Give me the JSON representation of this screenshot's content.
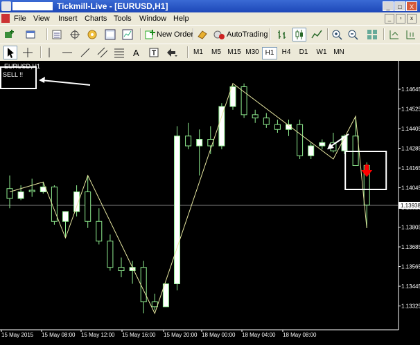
{
  "window": {
    "title": "Tickmill-Live - [EURUSD,H1]",
    "buttons": [
      "_",
      "□",
      "X"
    ]
  },
  "menu": [
    "File",
    "View",
    "Insert",
    "Charts",
    "Tools",
    "Window",
    "Help"
  ],
  "toolbar": {
    "new_order": "New Order",
    "autotrading": "AutoTrading"
  },
  "timeframes": [
    "M1",
    "M5",
    "M15",
    "M30",
    "H1",
    "H4",
    "D1",
    "W1",
    "MN"
  ],
  "active_timeframe": "H1",
  "chart": {
    "symbol_label": "EURUSD,H1",
    "annotation": "SELL !!",
    "current_price": "1.13938",
    "price_ticks": [
      "1.14645",
      "1.14525",
      "1.14405",
      "1.14285",
      "1.14165",
      "1.14045",
      "1.13925",
      "1.13805",
      "1.13685",
      "1.13565",
      "1.13445",
      "1.13325"
    ],
    "time_ticks": [
      "15 May 2015",
      "15 May 08:00",
      "15 May 12:00",
      "15 May 16:00",
      "15 May 20:00",
      "18 May 00:00",
      "18 May 04:00",
      "18 May 08:00"
    ],
    "colors": {
      "background": "#000000",
      "bull_body": "#ffffff",
      "bear_body": "#000000",
      "candle_wick": "#90ee90",
      "zigzag": "#e6e6a0",
      "price_line": "#808080",
      "signal_arrow": "#ff0000",
      "annotation": "#ffffff"
    }
  },
  "chart_data": {
    "type": "candlestick",
    "symbol": "EURUSD",
    "timeframe": "H1",
    "ylim": [
      1.1326,
      1.147
    ],
    "candles": [
      {
        "o": 1.1404,
        "h": 1.1412,
        "l": 1.1392,
        "c": 1.1398
      },
      {
        "o": 1.1398,
        "h": 1.1406,
        "l": 1.1397,
        "c": 1.1402
      },
      {
        "o": 1.1403,
        "h": 1.141,
        "l": 1.1399,
        "c": 1.1402
      },
      {
        "o": 1.1402,
        "h": 1.1408,
        "l": 1.1401,
        "c": 1.1405
      },
      {
        "o": 1.1405,
        "h": 1.1406,
        "l": 1.1382,
        "c": 1.1384
      },
      {
        "o": 1.1384,
        "h": 1.139,
        "l": 1.1374,
        "c": 1.139
      },
      {
        "o": 1.139,
        "h": 1.1406,
        "l": 1.1387,
        "c": 1.1402
      },
      {
        "o": 1.1402,
        "h": 1.1412,
        "l": 1.138,
        "c": 1.1384
      },
      {
        "o": 1.1384,
        "h": 1.1392,
        "l": 1.137,
        "c": 1.1372
      },
      {
        "o": 1.1372,
        "h": 1.1376,
        "l": 1.1354,
        "c": 1.1356
      },
      {
        "o": 1.1356,
        "h": 1.1362,
        "l": 1.135,
        "c": 1.1354
      },
      {
        "o": 1.1354,
        "h": 1.136,
        "l": 1.1346,
        "c": 1.1356
      },
      {
        "o": 1.1356,
        "h": 1.136,
        "l": 1.1328,
        "c": 1.1335
      },
      {
        "o": 1.1335,
        "h": 1.134,
        "l": 1.133,
        "c": 1.1332
      },
      {
        "o": 1.1332,
        "h": 1.1346,
        "l": 1.1332,
        "c": 1.1346
      },
      {
        "o": 1.1346,
        "h": 1.1442,
        "l": 1.1342,
        "c": 1.1436
      },
      {
        "o": 1.1436,
        "h": 1.1444,
        "l": 1.1428,
        "c": 1.143
      },
      {
        "o": 1.143,
        "h": 1.144,
        "l": 1.1412,
        "c": 1.1434
      },
      {
        "o": 1.1434,
        "h": 1.1442,
        "l": 1.1425,
        "c": 1.143
      },
      {
        "o": 1.143,
        "h": 1.1456,
        "l": 1.1428,
        "c": 1.1454
      },
      {
        "o": 1.1454,
        "h": 1.1467,
        "l": 1.1452,
        "c": 1.1466
      },
      {
        "o": 1.1466,
        "h": 1.1468,
        "l": 1.1447,
        "c": 1.1449
      },
      {
        "o": 1.1449,
        "h": 1.1452,
        "l": 1.1444,
        "c": 1.1447
      },
      {
        "o": 1.1447,
        "h": 1.145,
        "l": 1.1441,
        "c": 1.1443
      },
      {
        "o": 1.1443,
        "h": 1.1446,
        "l": 1.1438,
        "c": 1.144
      },
      {
        "o": 1.144,
        "h": 1.1446,
        "l": 1.1436,
        "c": 1.1443
      },
      {
        "o": 1.1443,
        "h": 1.1446,
        "l": 1.1422,
        "c": 1.1424
      },
      {
        "o": 1.1424,
        "h": 1.1432,
        "l": 1.1422,
        "c": 1.143
      },
      {
        "o": 1.143,
        "h": 1.1434,
        "l": 1.1428,
        "c": 1.1432
      },
      {
        "o": 1.1432,
        "h": 1.1438,
        "l": 1.1426,
        "c": 1.1427
      },
      {
        "o": 1.1427,
        "h": 1.1437,
        "l": 1.1425,
        "c": 1.1436
      },
      {
        "o": 1.1436,
        "h": 1.1448,
        "l": 1.142,
        "c": 1.1418
      },
      {
        "o": 1.1418,
        "h": 1.142,
        "l": 1.138,
        "c": 1.1394
      }
    ],
    "zigzag": [
      [
        0,
        1.1402
      ],
      [
        3,
        1.1408
      ],
      [
        5,
        1.1374
      ],
      [
        7,
        1.1412
      ],
      [
        13,
        1.1328
      ],
      [
        20,
        1.1468
      ],
      [
        29,
        1.1422
      ],
      [
        31,
        1.1448
      ],
      [
        32,
        1.138
      ]
    ],
    "current_price": 1.13938,
    "sell_signal_index": 32,
    "annotations": [
      "SELL !!"
    ]
  }
}
